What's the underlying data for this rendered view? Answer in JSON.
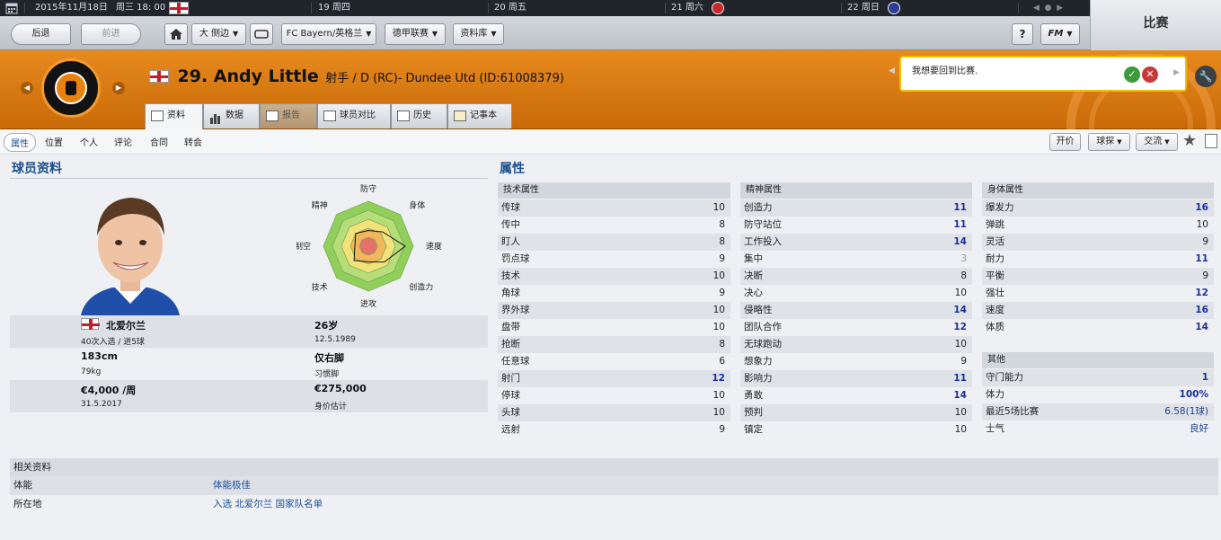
{
  "datebar": {
    "current": "2015年11月18日",
    "weekday_time": "周三 18: 00",
    "days": [
      "19 周四",
      "20 周五",
      "21 周六",
      "22 周日"
    ]
  },
  "nav": {
    "back": "后退",
    "forward": "前进",
    "view_mode": "大 侧边",
    "club": "FC Bayern/英格兰",
    "league": "德甲联赛",
    "database": "资料库",
    "help": "?",
    "fm": "FM"
  },
  "match_panel": {
    "label": "比赛"
  },
  "player": {
    "number_name": "29. Andy Little",
    "position_club": "射手 / D (RC)- Dundee Utd (ID:61008379)"
  },
  "tabs": [
    "资料",
    "数据",
    "报告",
    "球员对比",
    "历史",
    "记事本"
  ],
  "notification": {
    "text": "我想要回到比赛."
  },
  "subnav": {
    "links": [
      "属性",
      "位置",
      "个人",
      "评论",
      "合同",
      "转会"
    ],
    "buttons": [
      "开价",
      "球探",
      "交流"
    ]
  },
  "profile": {
    "title": "球员资料",
    "nationality": "北爱尔兰",
    "caps": "40次入选 / 进5球",
    "age": "26岁",
    "dob": "12.5.1989",
    "height": "183cm",
    "weight": "79kg",
    "foot": "仅右脚",
    "foot_label": "习惯脚",
    "wage": "€4,000 /周",
    "contract_end": "31.5.2017",
    "value": "€275,000",
    "value_label": "身价估计"
  },
  "radar": {
    "labels": [
      "防守",
      "身体",
      "速度",
      "创造力",
      "进攻",
      "技术",
      "制空",
      "精神"
    ],
    "values": [
      0.35,
      0.45,
      0.82,
      0.5,
      0.35,
      0.45,
      0.3,
      0.4
    ]
  },
  "attributes": {
    "title": "属性",
    "technical": {
      "header": "技术属性",
      "items": [
        {
          "name": "传球",
          "value": "10"
        },
        {
          "name": "传中",
          "value": "8"
        },
        {
          "name": "盯人",
          "value": "8"
        },
        {
          "name": "罚点球",
          "value": "9"
        },
        {
          "name": "技术",
          "value": "10"
        },
        {
          "name": "角球",
          "value": "9"
        },
        {
          "name": "界外球",
          "value": "10"
        },
        {
          "name": "盘带",
          "value": "10"
        },
        {
          "name": "抢断",
          "value": "8"
        },
        {
          "name": "任意球",
          "value": "6"
        },
        {
          "name": "射门",
          "value": "12"
        },
        {
          "name": "停球",
          "value": "10"
        },
        {
          "name": "头球",
          "value": "10"
        },
        {
          "name": "远射",
          "value": "9"
        }
      ]
    },
    "mental": {
      "header": "精神属性",
      "items": [
        {
          "name": "创造力",
          "value": "11"
        },
        {
          "name": "防守站位",
          "value": "11"
        },
        {
          "name": "工作投入",
          "value": "14"
        },
        {
          "name": "集中",
          "value": "3"
        },
        {
          "name": "决断",
          "value": "8"
        },
        {
          "name": "决心",
          "value": "10"
        },
        {
          "name": "侵略性",
          "value": "14"
        },
        {
          "name": "团队合作",
          "value": "12"
        },
        {
          "name": "无球跑动",
          "value": "10"
        },
        {
          "name": "想象力",
          "value": "9"
        },
        {
          "name": "影响力",
          "value": "11"
        },
        {
          "name": "勇敢",
          "value": "14"
        },
        {
          "name": "预判",
          "value": "10"
        },
        {
          "name": "镇定",
          "value": "10"
        }
      ]
    },
    "physical": {
      "header": "身体属性",
      "items": [
        {
          "name": "爆发力",
          "value": "16"
        },
        {
          "name": "弹跳",
          "value": "10"
        },
        {
          "name": "灵活",
          "value": "9"
        },
        {
          "name": "耐力",
          "value": "11"
        },
        {
          "name": "平衡",
          "value": "9"
        },
        {
          "name": "强壮",
          "value": "12"
        },
        {
          "name": "速度",
          "value": "16"
        },
        {
          "name": "体质",
          "value": "14"
        }
      ]
    },
    "other": {
      "header": "其他",
      "items": [
        {
          "name": "守门能力",
          "value": "1"
        },
        {
          "name": "体力",
          "value": "100%"
        },
        {
          "name": "最近5场比赛",
          "value": "6.58(1球)"
        },
        {
          "name": "士气",
          "value": "良好"
        }
      ]
    }
  },
  "related": {
    "header": "相关资料",
    "rows": [
      {
        "label": "体能",
        "value": "体能极佳"
      },
      {
        "label": "所在地",
        "value": "入选 北爱尔兰 国家队名单"
      }
    ]
  },
  "colors": {
    "accent_orange": "#e07c14",
    "link_blue": "#1a4f8a",
    "highlight": "#1a2fa0"
  }
}
